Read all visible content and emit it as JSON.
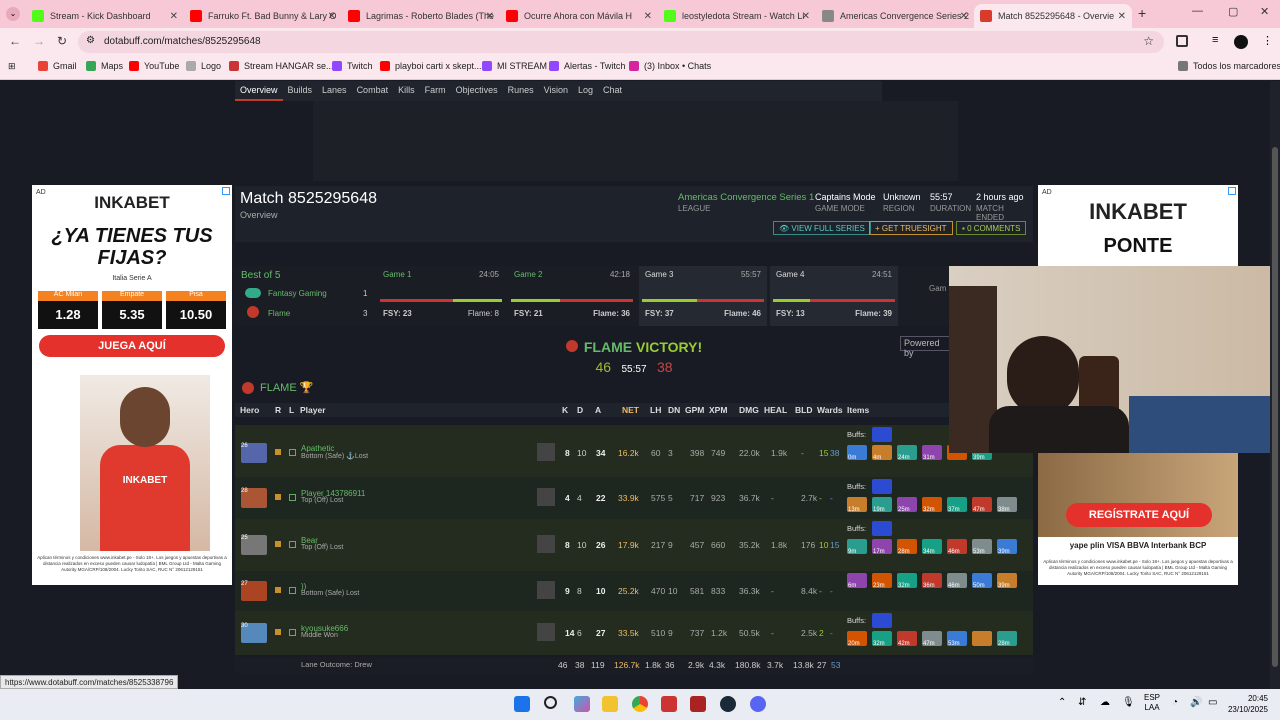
{
  "tabs": [
    {
      "title": "Stream - Kick Dashboard",
      "color": "#53fc18"
    },
    {
      "title": "Farruko Ft. Bad Bunny & Lary O",
      "color": "#ff0000"
    },
    {
      "title": "Lagrimas - Roberto Blades (The",
      "color": "#ff0000"
    },
    {
      "title": "Ocurre Ahora con Mávila H",
      "color": "#ff0000"
    },
    {
      "title": "leostyledota Stream - Watch Li",
      "color": "#53fc18"
    },
    {
      "title": "Americas Convergence Series 2",
      "color": "#888888"
    },
    {
      "title": "Match 8525295648 - Overvie",
      "color": "#d83a2c"
    }
  ],
  "address": {
    "url": "dotabuff.com/matches/8525295648"
  },
  "bookmarks": [
    "Gmail",
    "Maps",
    "YouTube",
    "Logo",
    "Stream HANGAR se...",
    "Twitch",
    "playboi carti x skept...",
    "MI STREAM",
    "Alertas - Twitch",
    "(3) Inbox • Chats",
    "Todos los marcadores"
  ],
  "subnav": [
    "Overview",
    "Builds",
    "Lanes",
    "Combat",
    "Kills",
    "Farm",
    "Objectives",
    "Runes",
    "Vision",
    "Log",
    "Chat"
  ],
  "ad_left": {
    "label": "AD",
    "brand": "INKABET",
    "headline": "¿YA TIENES TUS FIJAS?",
    "league": "Italia Serie A",
    "odds": [
      {
        "name": "AC Milan",
        "value": "1.28"
      },
      {
        "name": "Empate",
        "value": "5.35"
      },
      {
        "name": "Pisa",
        "value": "10.50"
      }
    ],
    "cta": "JUEGA AQUÍ",
    "fine": "Aplican términos y condiciones www.inkabet.pe - Solo 18+. Los juegos y apuestas deportivas a distancia realizados en exceso pueden causar ludopatía | BML Group Ltd - Malta Gaming Autority MGA/CRP/108/2004. Lucky Torito SAC, RUC N° 20612129151",
    "brand_shirt": "INKABET"
  },
  "ad_right": {
    "label": "AD",
    "brand": "INKABET",
    "headline": "PONTE",
    "cta": "REGÍSTRATE AQUÍ",
    "payments": "yape plin VISA BBVA Interbank BCP",
    "fine": "Aplican términos y condiciones www.inkabet.pe - Solo 18+. Los juegos y apuestas deportivas a distancia realizados en exceso pueden causar ludopatía | BML Group Ltd - Malta Gaming Autority MGA/CRP/108/2004. Lucky Torito SAC, RUC N° 20612129151"
  },
  "match": {
    "title": "Match 8525295648",
    "subtitle": "Overview",
    "league": "Americas Convergence Series 1",
    "league_label": "LEAGUE",
    "mode": "Captains Mode",
    "mode_label": "GAME MODE",
    "region": "Unknown",
    "region_label": "REGION",
    "duration": "55:57",
    "duration_label": "DURATION",
    "ended": "2 hours ago",
    "ended_label": "MATCH ENDED",
    "btn_series": "VIEW FULL SERIES",
    "btn_truesight": "GET TRUESIGHT",
    "btn_comments": "0 COMMENTS"
  },
  "series": {
    "label": "Best of 5",
    "teams": [
      {
        "name": "Fantasy Gaming",
        "score": "1"
      },
      {
        "name": "Flame",
        "score": "3"
      }
    ],
    "games": [
      {
        "name": "Game 1",
        "time": "24:05",
        "left": "FSY: 23",
        "right": "Flame: 8",
        "split": 0.6
      },
      {
        "name": "Game 2",
        "time": "42:18",
        "left": "FSY: 21",
        "right": "Flame: 36",
        "split": 0.4
      },
      {
        "name": "Game 3",
        "time": "55:57",
        "left": "FSY: 37",
        "right": "Flame: 46",
        "split": 0.45
      },
      {
        "name": "Game 4",
        "time": "24:51",
        "left": "FSY: 13",
        "right": "Flame: 39",
        "split": 0.3
      }
    ],
    "extra": "Gam",
    "powered": "Powered by"
  },
  "victory": {
    "text1": "FLAME",
    "text2": "VICTORY!",
    "score_left": "46",
    "time": "55:57",
    "score_right": "38"
  },
  "team": {
    "name": "FLAME"
  },
  "columns": [
    "Hero",
    "R",
    "L",
    "Player",
    "K",
    "D",
    "A",
    "NET",
    "LH",
    "DN",
    "GPM",
    "XPM",
    "DMG",
    "HEAL",
    "BLD",
    "Wards",
    "Items"
  ],
  "rows": [
    {
      "level": "26",
      "player": "Apathetic",
      "lane": "Bottom (Safe) ⚓Lost",
      "k": "8",
      "d": "10",
      "a": "34",
      "net": "16.2k",
      "lh": "60",
      "dn": "3",
      "gpm": "398",
      "xpm": "749",
      "dmg": "22.0k",
      "heal": "1.9k",
      "bld": "-",
      "wards": "15",
      "wards2": "38",
      "buffs": "Buffs:",
      "times": [
        "0m",
        "4m",
        "24m",
        "31m",
        "",
        "39m"
      ],
      "items_row": "1"
    },
    {
      "level": "28",
      "player": "Player 143786911",
      "lane": "Top (Off) Lost",
      "k": "4",
      "d": "4",
      "a": "22",
      "net": "33.9k",
      "lh": "575",
      "dn": "5",
      "gpm": "717",
      "xpm": "923",
      "dmg": "36.7k",
      "heal": "-",
      "bld": "2.7k",
      "wards": "-",
      "wards2": "-",
      "buffs": "Buffs:",
      "times": [
        "13m",
        "19m",
        "25m",
        "32m",
        "37m",
        "47m",
        "38m"
      ],
      "items_row": "2"
    },
    {
      "level": "25",
      "player": "Bear",
      "lane": "Top (Off) Lost",
      "k": "8",
      "d": "10",
      "a": "26",
      "net": "17.9k",
      "lh": "217",
      "dn": "9",
      "gpm": "457",
      "xpm": "660",
      "dmg": "35.2k",
      "heal": "1.8k",
      "bld": "176",
      "wards": "10",
      "wards2": "15",
      "buffs": "Buffs:",
      "times": [
        "9m",
        "17m",
        "28m",
        "34m",
        "46m",
        "53m",
        "39m"
      ],
      "items_row": "3"
    },
    {
      "level": "27",
      "player": "))",
      "lane": "Bottom (Safe) Lost",
      "k": "9",
      "d": "8",
      "a": "10",
      "net": "25.2k",
      "lh": "470",
      "dn": "10",
      "gpm": "581",
      "xpm": "833",
      "dmg": "36.3k",
      "heal": "-",
      "bld": "8.4k",
      "wards": "-",
      "wards2": "-",
      "buffs": "",
      "times": [
        "6m",
        "23m",
        "32m",
        "36m",
        "46m",
        "50m",
        "39m"
      ],
      "items_row": "4"
    },
    {
      "level": "30",
      "player": "kyousuke666",
      "lane": "Middle Won",
      "k": "14",
      "d": "6",
      "a": "27",
      "net": "33.5k",
      "lh": "510",
      "dn": "9",
      "gpm": "737",
      "xpm": "1.2k",
      "dmg": "50.5k",
      "heal": "-",
      "bld": "2.5k",
      "wards": "2",
      "wards2": "-",
      "buffs": "Buffs:",
      "times": [
        "20m",
        "32m",
        "42m",
        "47m",
        "53m",
        "",
        "28m"
      ],
      "items_row": "5"
    }
  ],
  "totals": {
    "label": "Lane Outcome: Drew",
    "k": "46",
    "d": "38",
    "a": "119",
    "net": "126.7k",
    "lh": "1.8k",
    "dn": "36",
    "gpm": "2.9k",
    "xpm": "4.3k",
    "dmg": "180.8k",
    "heal": "3.7k",
    "bld": "13.8k",
    "wards": "27",
    "wards2": "53"
  },
  "status_url": "https://www.dotabuff.com/matches/8525338796",
  "taskbar": {
    "lang": "ESP",
    "lang2": "LAA",
    "time": "20:45",
    "date": "23/10/2025"
  }
}
